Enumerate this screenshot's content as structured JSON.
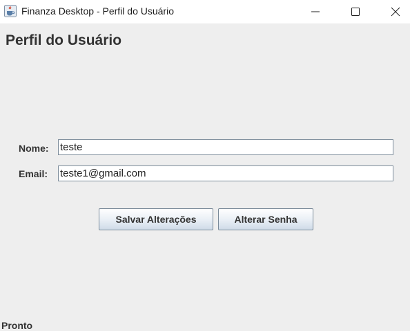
{
  "window": {
    "title": "Finanza Desktop - Perfil do Usuário",
    "icon": "java-cup-icon",
    "controls": [
      "minimize-icon",
      "maximize-icon",
      "close-icon"
    ]
  },
  "page": {
    "title": "Perfil do Usuário"
  },
  "form": {
    "nome_label": "Nome:",
    "nome_value": "teste",
    "email_label": "Email:",
    "email_value": "teste1@gmail.com"
  },
  "actions": {
    "save_label": "Salvar Alterações",
    "change_password_label": "Alterar Senha"
  },
  "status": {
    "text": "Pronto"
  }
}
